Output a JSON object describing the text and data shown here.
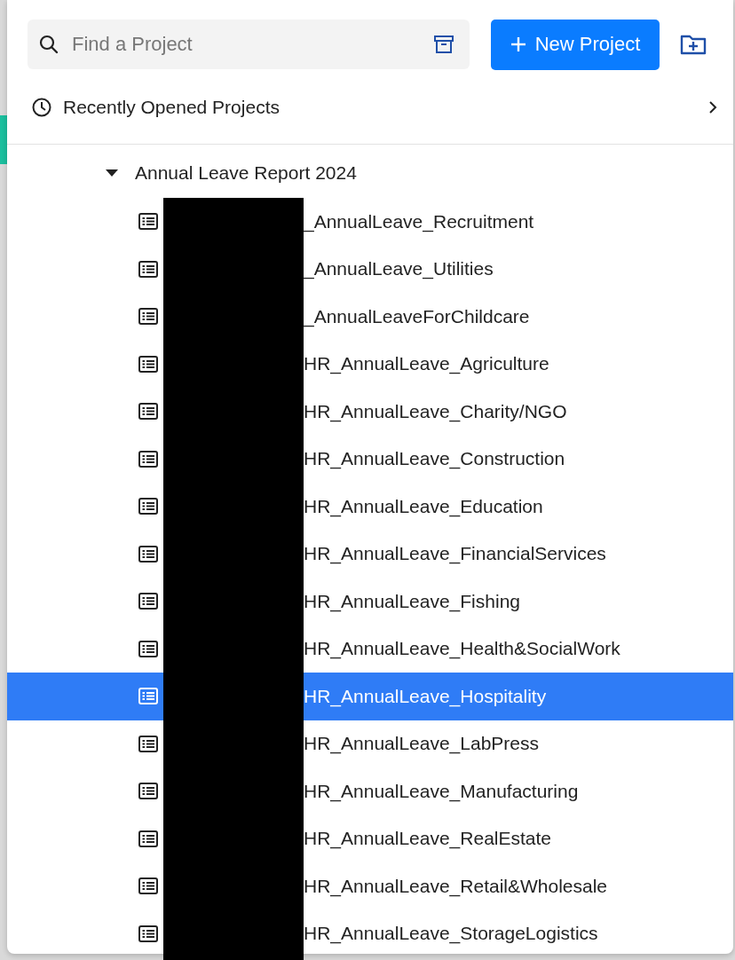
{
  "search": {
    "placeholder": "Find a Project"
  },
  "new_project_button": {
    "label": "New Project"
  },
  "recent": {
    "label": "Recently Opened Projects"
  },
  "folder": {
    "name": "Annual Leave Report 2024",
    "expanded": true,
    "items": [
      {
        "name": "_AnnualLeave_Recruitment",
        "selected": false
      },
      {
        "name": "_AnnualLeave_Utilities",
        "selected": false
      },
      {
        "name": "_AnnualLeaveForChildcare",
        "selected": false
      },
      {
        "name": "HR_AnnualLeave_Agriculture",
        "selected": false
      },
      {
        "name": "HR_AnnualLeave_Charity/NGO",
        "selected": false
      },
      {
        "name": "HR_AnnualLeave_Construction",
        "selected": false
      },
      {
        "name": "HR_AnnualLeave_Education",
        "selected": false
      },
      {
        "name": "HR_AnnualLeave_FinancialServices",
        "selected": false
      },
      {
        "name": "HR_AnnualLeave_Fishing",
        "selected": false
      },
      {
        "name": "HR_AnnualLeave_Health&SocialWork",
        "selected": false
      },
      {
        "name": "HR_AnnualLeave_Hospitality",
        "selected": true
      },
      {
        "name": "HR_AnnualLeave_LabPress",
        "selected": false
      },
      {
        "name": "HR_AnnualLeave_Manufacturing",
        "selected": false
      },
      {
        "name": "HR_AnnualLeave_RealEstate",
        "selected": false
      },
      {
        "name": "HR_AnnualLeave_Retail&Wholesale",
        "selected": false
      },
      {
        "name": "HR_AnnualLeave_StorageLogistics",
        "selected": false
      }
    ]
  }
}
